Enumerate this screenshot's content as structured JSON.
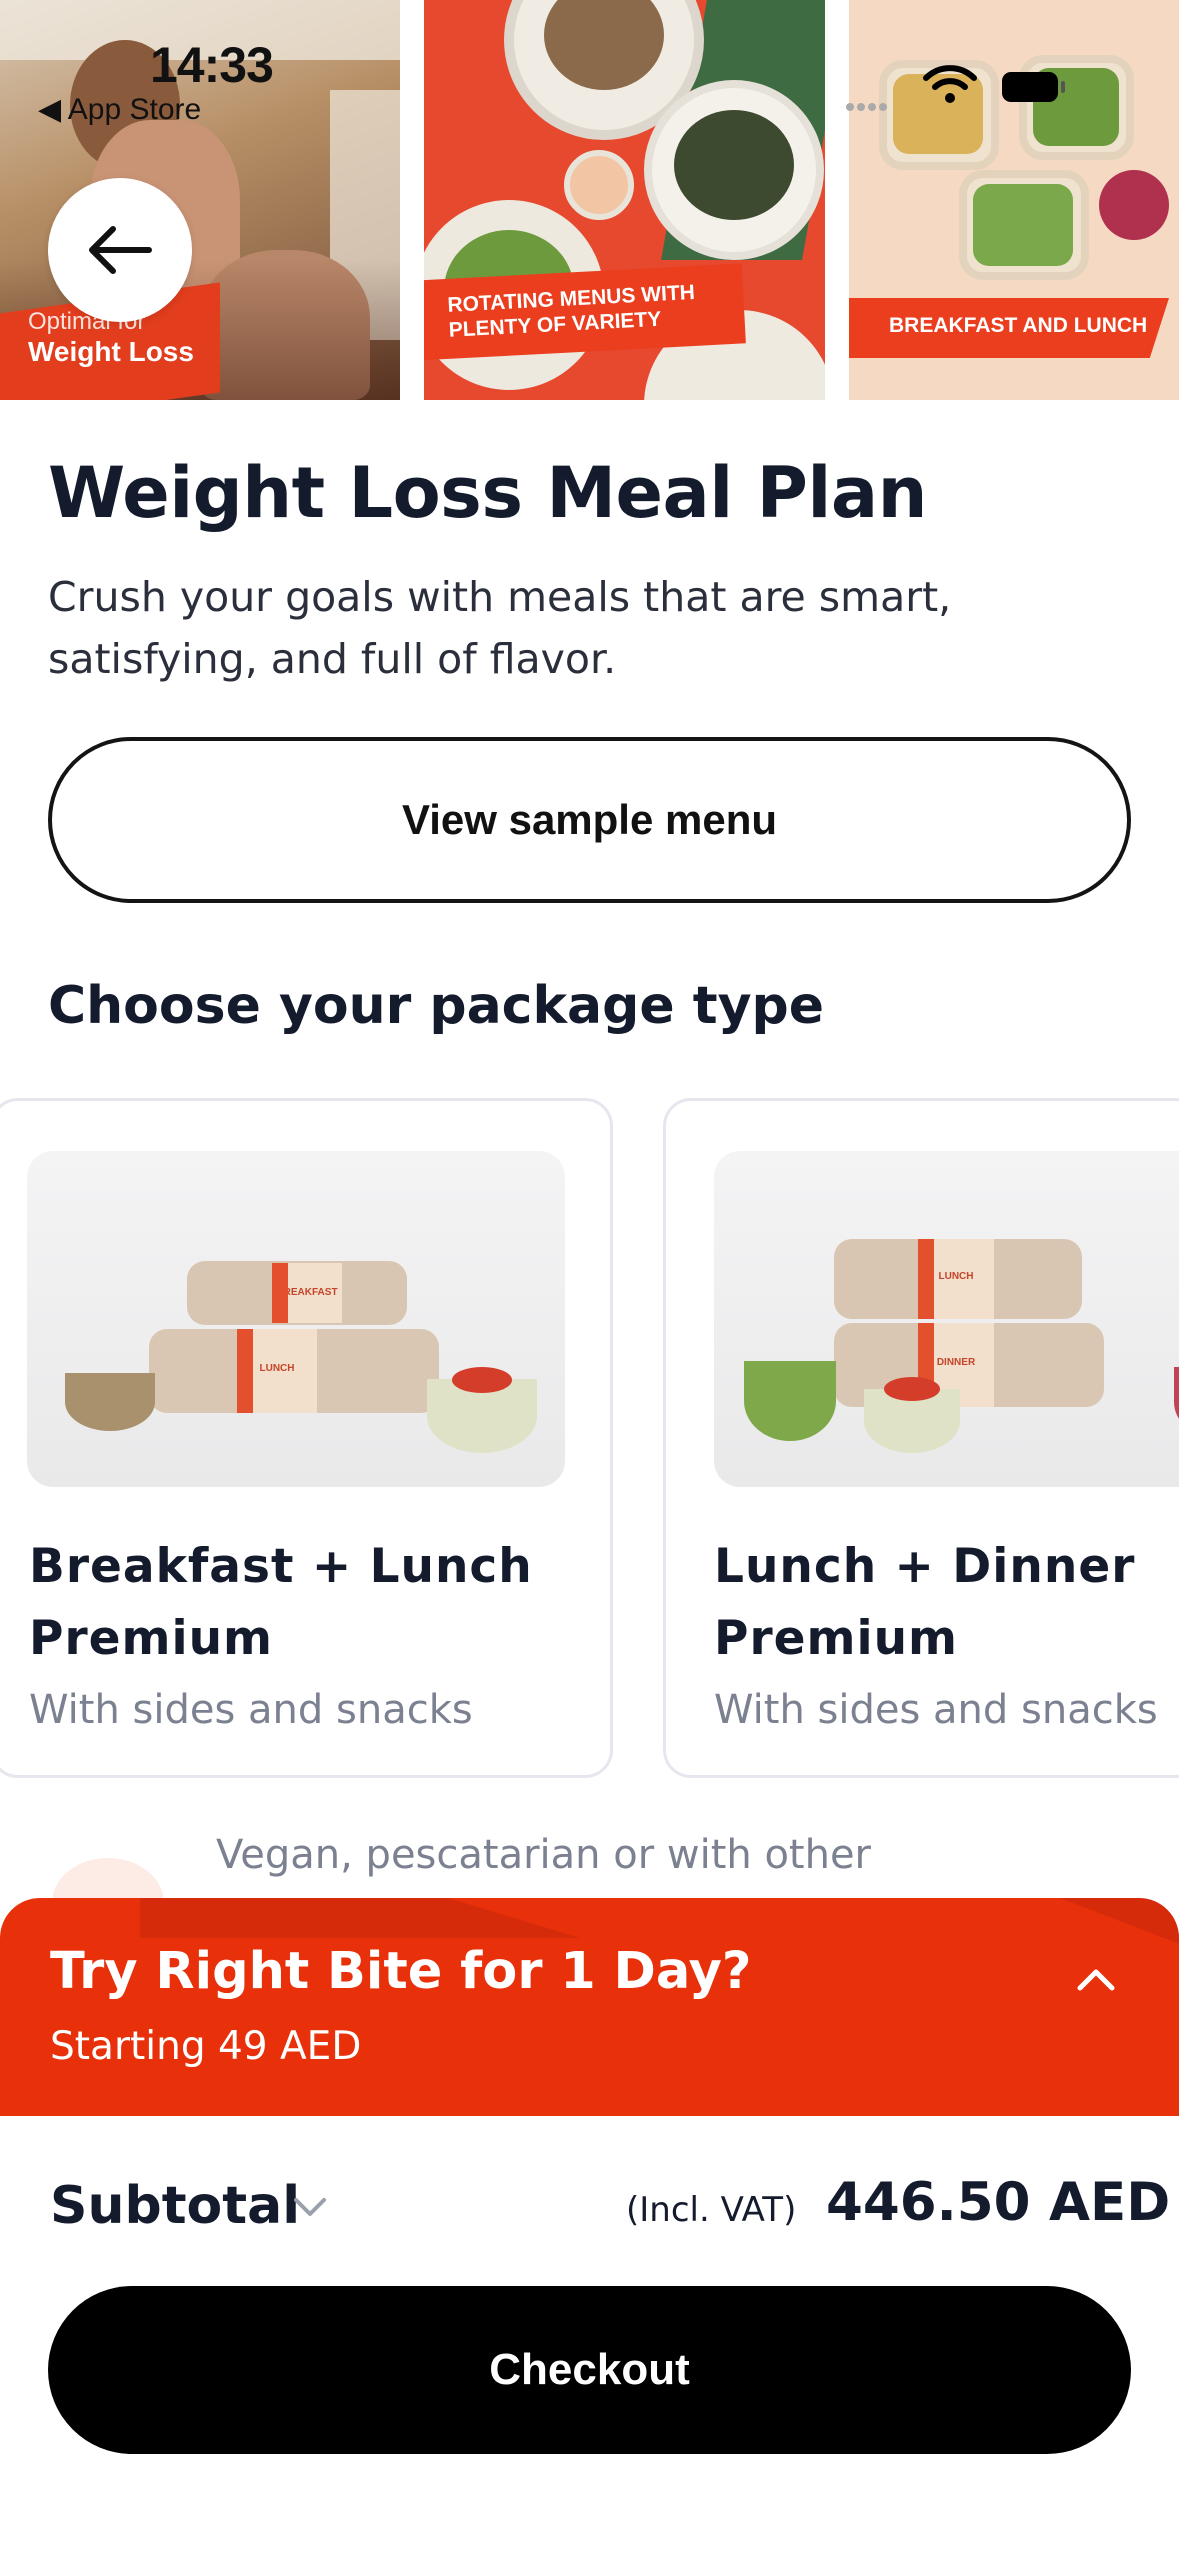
{
  "status_bar": {
    "time": "14:33",
    "back_label": "App Store"
  },
  "hero": {
    "slide1_caption_small": "Optimal for",
    "slide1_caption_big": "Weight Loss",
    "slide2_banner_line1": "ROTATING MENUS WITH",
    "slide2_banner_line2": "PLENTY OF VARIETY",
    "slide3_banner": "BREAKFAST AND LUNCH"
  },
  "page": {
    "title": "Weight Loss Meal Plan",
    "subtitle": "Crush your goals with meals that are smart, satisfying, and full of flavor.",
    "sample_menu_label": "View sample menu",
    "section_title": "Choose your package type"
  },
  "packages": [
    {
      "title": "Breakfast + Lunch Premium",
      "subtitle": "With sides and snacks",
      "tray_top_label": "BREAKFAST",
      "tray_bottom_label": "LUNCH"
    },
    {
      "title": "Lunch + Dinner Premium",
      "subtitle": "With sides and snacks",
      "tray_top_label": "LUNCH",
      "tray_bottom_label": "DINNER"
    }
  ],
  "dietary_note": "Vegan, pescatarian or with other",
  "promo": {
    "title": "Try Right Bite for 1 Day?",
    "subtitle": "Starting 49 AED",
    "color": "#e8300a"
  },
  "summary": {
    "subtotal_label": "Subtotal",
    "vat_label": "(Incl. VAT)",
    "price": "446.50 AED",
    "checkout_label": "Checkout"
  },
  "icons": {
    "back": "arrow-left-icon",
    "expand": "chevron-up-icon",
    "subtotal_toggle": "chevron-down-icon"
  }
}
